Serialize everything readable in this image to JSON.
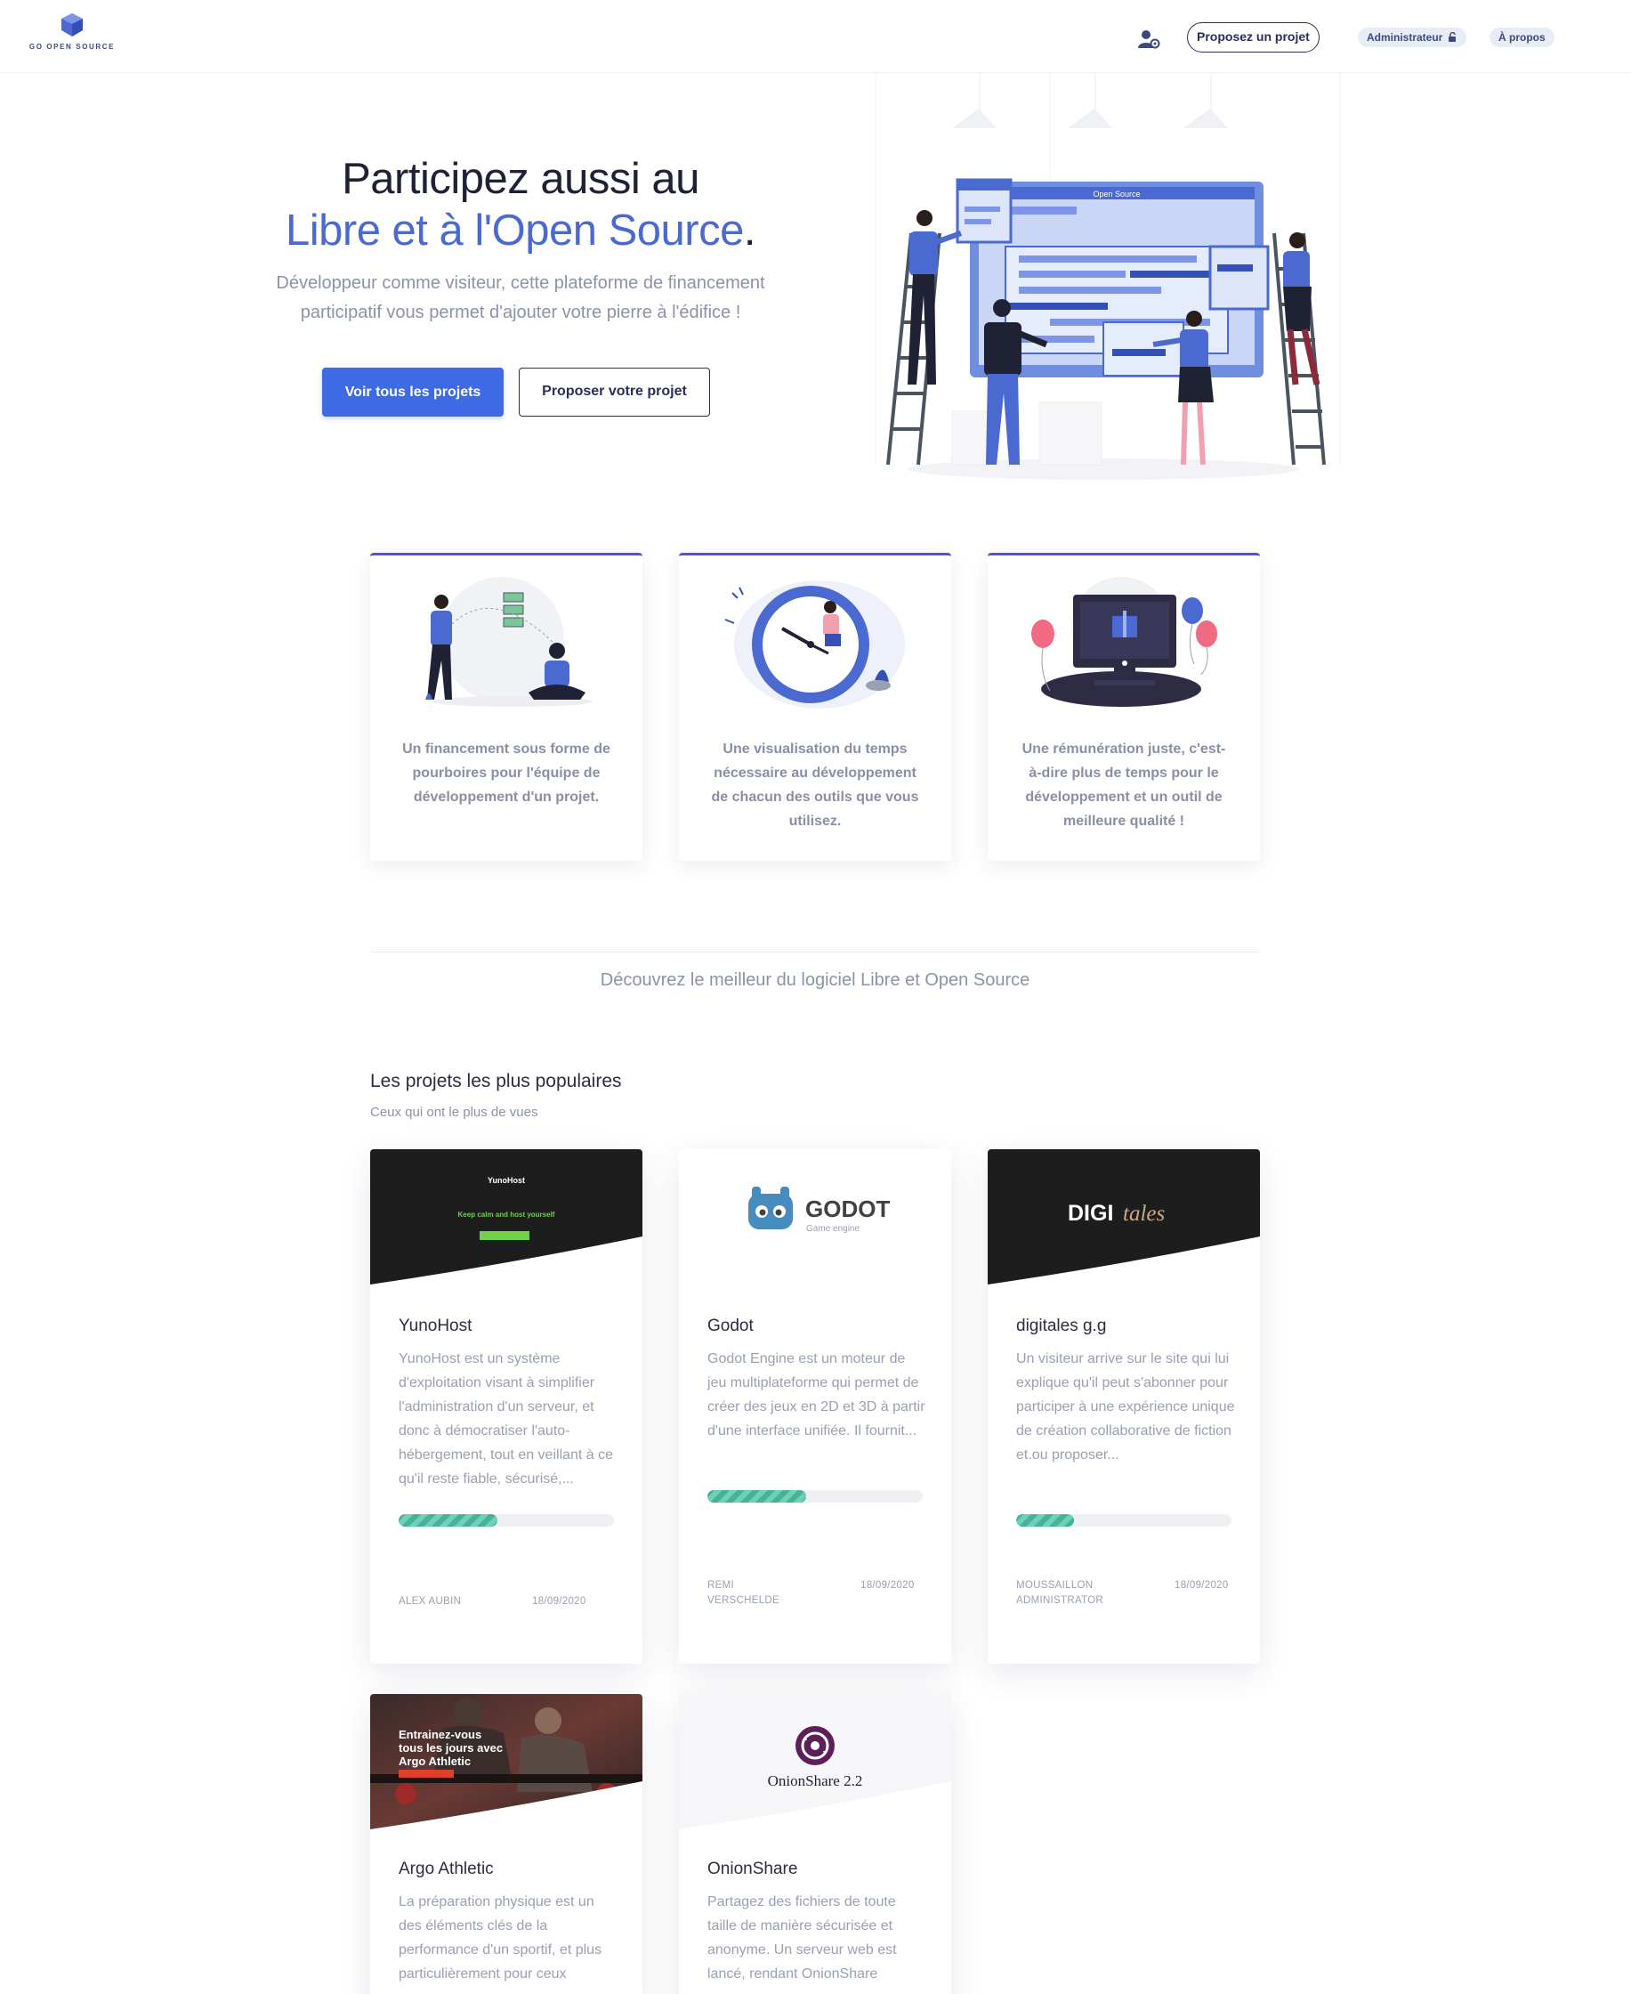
{
  "header": {
    "logo_text": "GO OPEN SOURCE",
    "propose_label": "Proposez un projet",
    "admin_label": "Administrateur",
    "about_label": "À propos"
  },
  "hero": {
    "title_line1": "Participez aussi au",
    "title_accent": "Libre et à l'Open Source",
    "title_end": ".",
    "subtitle": "Développeur comme visiteur, cette plateforme de financement participatif vous permet d'ajouter votre pierre à l'édifice !",
    "cta_primary": "Voir tous les projets",
    "cta_secondary": "Proposer votre projet",
    "illustration_window_label": "Open Source"
  },
  "features": [
    {
      "text": "Un financement sous forme de pourboires pour l'équipe de développement d'un projet."
    },
    {
      "text": "Une visualisation du temps nécessaire au développement de chacun des outils que vous utilisez."
    },
    {
      "text": "Une rémunération juste, c'est-à-dire plus de temps pour le développement et un outil de meilleure qualité !"
    }
  ],
  "discover_text": "Découvrez le meilleur du logiciel Libre et Open Source",
  "popular": {
    "title": "Les projets les plus populaires",
    "subtitle": "Ceux qui ont le plus de vues"
  },
  "projects": [
    {
      "name": "YunoHost",
      "description": "YunoHost est un système d'exploitation visant à simplifier l'administration d'un serveur, et donc à démocratiser l'auto-hébergement, tout en veillant à ce qu'il reste fiable, sécurisé,...",
      "progress": 0.46,
      "author": "ALEX AUBIN",
      "date": "18/09/2020",
      "thumb_logo": "YunoHost",
      "thumb_tagline": "Keep calm and host yourself"
    },
    {
      "name": "Godot",
      "description": "Godot Engine est un moteur de jeu multiplateforme qui permet de créer des jeux en 2D et 3D à partir d'une interface unifiée. Il fournit...",
      "progress": 0.46,
      "author_line1": "REMI",
      "author_line2": "VERSCHELDE",
      "date": "18/09/2020",
      "thumb_logo": "GODOT",
      "thumb_tagline": "Game engine"
    },
    {
      "name": "digitales g.g",
      "description": "Un visiteur arrive sur le site qui lui explique qu'il peut s'abonner pour participer à une expérience unique de création collaborative de fiction et.ou proposer...",
      "progress": 0.27,
      "author_line1": "MOUSSAILLON",
      "author_line2": "ADMINISTRATOR",
      "date": "18/09/2020",
      "thumb_logo_a": "DIGI",
      "thumb_logo_b": "tales"
    },
    {
      "name": "Argo Athletic",
      "description": "La préparation physique est un des éléments clés de la performance d'un sportif, et plus particulièrement pour ceux",
      "thumb_text_1": "Entrainez-vous",
      "thumb_text_2": "tous les jours avec",
      "thumb_text_3": "Argo Athletic"
    },
    {
      "name": "OnionShare",
      "description": "Partagez des fichiers de toute taille de manière sécurisée et anonyme. Un serveur web est lancé, rendant OnionShare",
      "thumb_logo": "OnionShare 2.2"
    }
  ],
  "colors": {
    "accent": "#4a6ad2",
    "primary_button": "#3f6ae6",
    "progress": "#44b39a",
    "feature_border": "#5a4fcf"
  }
}
